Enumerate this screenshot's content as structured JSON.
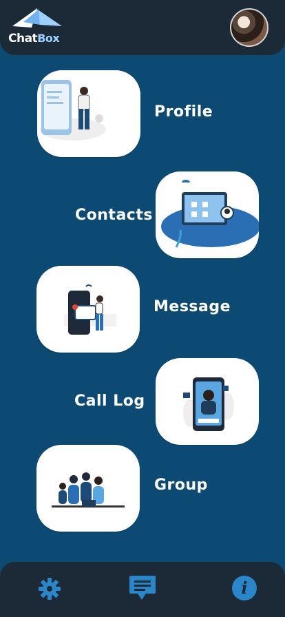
{
  "app": {
    "logo_text_primary": "Chat",
    "logo_text_secondary": "Box"
  },
  "menu": {
    "items": [
      {
        "label": "Profile",
        "icon": "profile-illustration"
      },
      {
        "label": "Contacts",
        "icon": "contacts-illustration"
      },
      {
        "label": "Message",
        "icon": "message-illustration"
      },
      {
        "label": "Call Log",
        "icon": "call-log-illustration"
      },
      {
        "label": "Group",
        "icon": "group-illustration"
      }
    ]
  },
  "footer": {
    "settings_icon": "gear-icon",
    "chat_icon": "chat-icon",
    "info_icon": "info-icon",
    "info_glyph": "i"
  },
  "colors": {
    "background": "#0c4a73",
    "bar": "#1b2a36",
    "accent": "#2a86c9",
    "card": "#ffffff"
  }
}
